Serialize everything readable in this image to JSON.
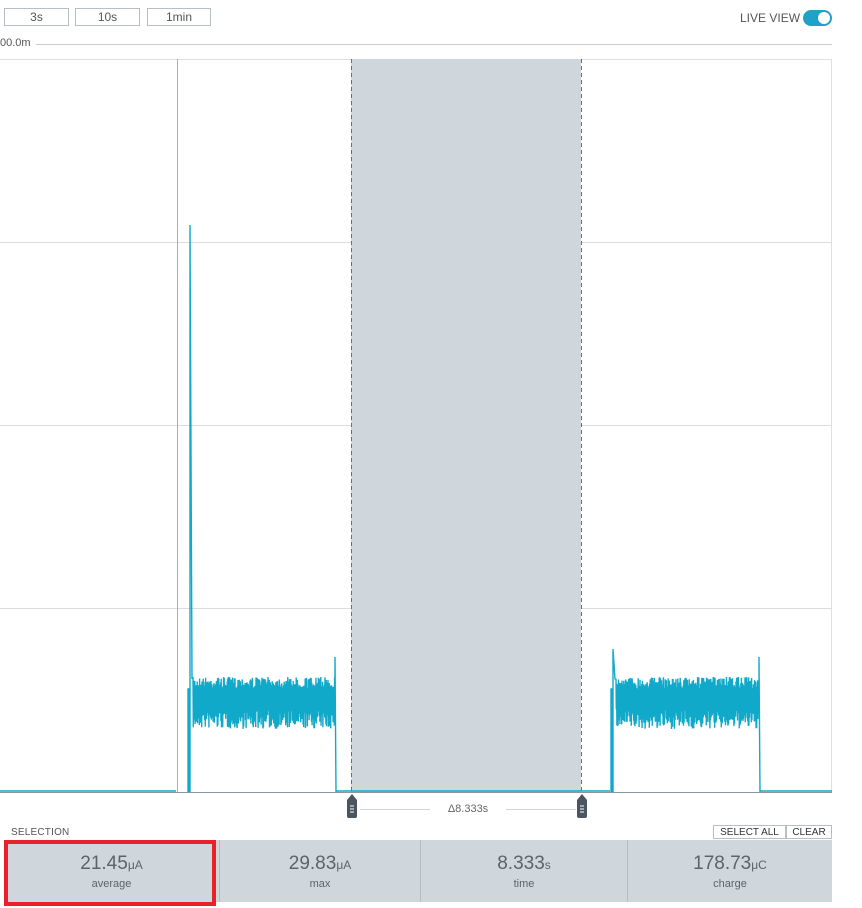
{
  "toolbar": {
    "windows": [
      "3s",
      "10s",
      "1min"
    ],
    "live_view_label": "LIVE VIEW",
    "live_view_on": true
  },
  "ruler": {
    "label": "00.0m"
  },
  "chart_data": {
    "type": "line",
    "series": [
      {
        "values": []
      }
    ],
    "colors": {
      "trace": "#10a9c9",
      "selection": "#d0d7dc",
      "grid": "#d8dde1"
    },
    "grid": true,
    "selection_delta": "Δ8.333s"
  },
  "selection": {
    "label": "SELECTION",
    "select_all": "SELECT ALL",
    "clear": "CLEAR",
    "stats": [
      {
        "value": "21.45",
        "unit": "μA",
        "label": "average"
      },
      {
        "value": "29.83",
        "unit": "μA",
        "label": "max"
      },
      {
        "value": "8.333",
        "unit": "s",
        "label": "time"
      },
      {
        "value": "178.73",
        "unit": "μC",
        "label": "charge"
      }
    ]
  },
  "colors": {
    "accent": "#1fa2c7",
    "highlight": "#e8212b"
  }
}
